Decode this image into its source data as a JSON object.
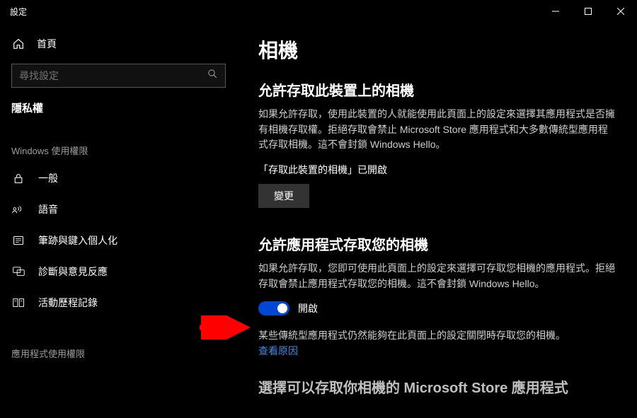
{
  "window": {
    "title": "設定"
  },
  "sidebar": {
    "home": "首頁",
    "search_placeholder": "尋找設定",
    "category": "隱私權",
    "section1": "Windows 使用權限",
    "items": [
      {
        "label": "一般"
      },
      {
        "label": "語音"
      },
      {
        "label": "筆跡與鍵入個人化"
      },
      {
        "label": "診斷與意見反應"
      },
      {
        "label": "活動歷程記錄"
      }
    ],
    "section2": "應用程式使用權限"
  },
  "content": {
    "title": "相機",
    "section1": {
      "heading": "允許存取此裝置上的相機",
      "desc": "如果允許存取，使用此裝置的人就能使用此頁面上的設定來選擇其應用程式是否擁有相機存取權。拒絕存取會禁止 Microsoft Store 應用程式和大多數傳統型應用程式存取相機。這不會封鎖 Windows Hello。",
      "status": "「存取此裝置的相機」已開啟",
      "button": "變更"
    },
    "section2": {
      "heading": "允許應用程式存取您的相機",
      "desc": "如果允許存取，您即可使用此頁面上的設定來選擇可存取您相機的應用程式。拒絕存取會禁止應用程式存取您的相機。這不會封鎖 Windows Hello。",
      "toggle_label": "開啟",
      "note": "某些傳統型應用程式仍然能夠在此頁面上的設定關閉時存取您的相機。",
      "link": "查看原因"
    },
    "section3_cut": "選擇可以存取你相機的 Microsoft Store 應用程式"
  }
}
